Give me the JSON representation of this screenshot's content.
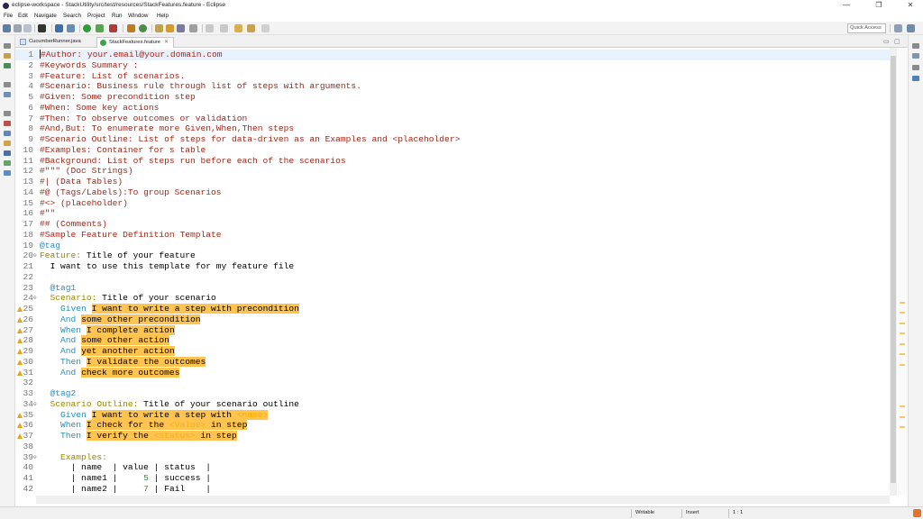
{
  "window": {
    "title": "eclipse-workspace - StackUtility/src/test/resources/StackFeatures.feature - Eclipse",
    "controls": [
      "—",
      "❐",
      "✕"
    ]
  },
  "menu": [
    "File",
    "Edit",
    "Navigate",
    "Search",
    "Project",
    "Run",
    "Window",
    "Help"
  ],
  "toolbar": {
    "quick_access": "Quick Access"
  },
  "tabs": [
    {
      "label": "CucumberRunner.java",
      "active": false
    },
    {
      "label": "StackFeatures.feature",
      "active": true
    }
  ],
  "editor": {
    "lines": [
      {
        "n": "1",
        "text": "#Author: your.email@your.domain.com"
      },
      {
        "n": "2",
        "text": "#Keywords Summary :"
      },
      {
        "n": "3",
        "text": "#Feature: List of scenarios."
      },
      {
        "n": "4",
        "text": "#Scenario: Business rule through list of steps with arguments."
      },
      {
        "n": "5",
        "text": "#Given: Some precondition step"
      },
      {
        "n": "6",
        "text": "#When: Some key actions"
      },
      {
        "n": "7",
        "text": "#Then: To observe outcomes or validation"
      },
      {
        "n": "8",
        "text": "#And,But: To enumerate more Given,When,Then steps"
      },
      {
        "n": "9",
        "text": "#Scenario Outline: List of steps for data-driven as an Examples and <placeholder>"
      },
      {
        "n": "10",
        "text": "#Examples: Container for s table"
      },
      {
        "n": "11",
        "text": "#Background: List of steps run before each of the scenarios"
      },
      {
        "n": "12",
        "text": "#\"\"\" (Doc Strings)"
      },
      {
        "n": "13",
        "text": "#| (Data Tables)"
      },
      {
        "n": "14",
        "text": "#@ (Tags/Labels):To group Scenarios"
      },
      {
        "n": "15",
        "text": "#<> (placeholder)"
      },
      {
        "n": "16",
        "text": "#\"\""
      },
      {
        "n": "17",
        "text": "## (Comments)"
      },
      {
        "n": "18",
        "text": "#Sample Feature Definition Template"
      },
      {
        "n": "19",
        "text": "@tag"
      },
      {
        "n": "20",
        "kw": "Feature:",
        "text": " Title of your feature"
      },
      {
        "n": "21",
        "text": "  I want to use this template for my feature file"
      },
      {
        "n": "22",
        "text": ""
      },
      {
        "n": "23",
        "text": "  @tag1"
      },
      {
        "n": "24",
        "kw": "  Scenario:",
        "text": " Title of your scenario"
      },
      {
        "n": "25",
        "step": "    Given ",
        "hl": "I want to write a step with precondition"
      },
      {
        "n": "26",
        "step": "    And ",
        "hl": "some other precondition"
      },
      {
        "n": "27",
        "step": "    When ",
        "hl": "I complete action"
      },
      {
        "n": "28",
        "step": "    And ",
        "hl": "some other action"
      },
      {
        "n": "29",
        "step": "    And ",
        "hl": "yet another action"
      },
      {
        "n": "30",
        "step": "    Then ",
        "hl": "I validate the outcomes"
      },
      {
        "n": "31",
        "step": "    And ",
        "hl": "check more outcomes"
      },
      {
        "n": "32",
        "text": ""
      },
      {
        "n": "33",
        "text": "  @tag2"
      },
      {
        "n": "34",
        "kw": "  Scenario Outline:",
        "text": " Title of your scenario outline"
      },
      {
        "n": "35",
        "step": "    Given ",
        "hl": "I want to write a step with ",
        "ph": "<name>",
        "hl2": ""
      },
      {
        "n": "36",
        "step": "    When ",
        "hl": "I check for the ",
        "ph": "<value>",
        "hl2": " in step"
      },
      {
        "n": "37",
        "step": "    Then ",
        "hl": "I verify the ",
        "ph": "<status>",
        "hl2": " in step"
      },
      {
        "n": "38",
        "text": ""
      },
      {
        "n": "39",
        "kw": "    Examples:",
        "text": ""
      },
      {
        "n": "40",
        "table": [
          "      | name  | value | status  |"
        ]
      },
      {
        "n": "41",
        "table": [
          "      | name1 |     ",
          "5",
          " | success |"
        ]
      },
      {
        "n": "42",
        "table": [
          "      | name2 |     ",
          "7",
          " | Fail    |"
        ]
      }
    ]
  },
  "status": {
    "writable": "Writable",
    "insert": "Insert",
    "position": "1 : 1"
  }
}
